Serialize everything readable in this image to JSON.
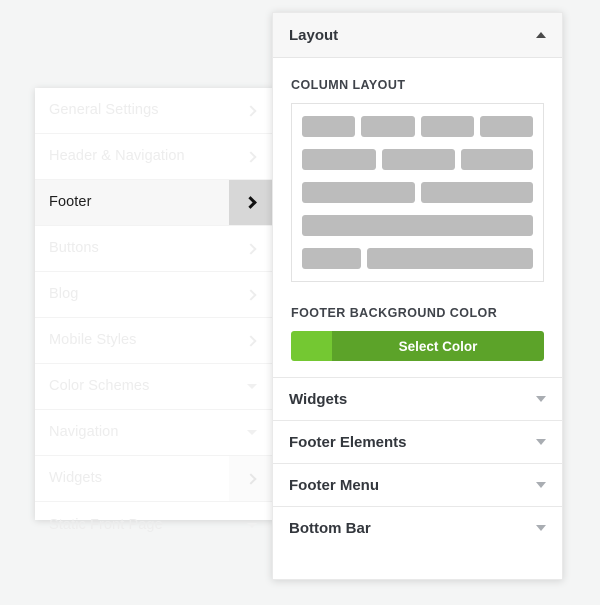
{
  "sidebar": {
    "items": [
      {
        "label": "General Settings",
        "indicator": "chevron-right-icon",
        "state": "inactive"
      },
      {
        "label": "Header & Navigation",
        "indicator": "chevron-right-icon",
        "state": "inactive"
      },
      {
        "label": "Footer",
        "indicator": "chevron-right-icon",
        "state": "active"
      },
      {
        "label": "Buttons",
        "indicator": "chevron-right-icon",
        "state": "inactive"
      },
      {
        "label": "Blog",
        "indicator": "chevron-right-icon",
        "state": "inactive"
      },
      {
        "label": "Mobile Styles",
        "indicator": "chevron-right-icon",
        "state": "inactive"
      },
      {
        "label": "Color Schemes",
        "indicator": "chevron-down-icon",
        "state": "inactive"
      },
      {
        "label": "Navigation",
        "indicator": "chevron-down-icon",
        "state": "inactive"
      },
      {
        "label": "Widgets",
        "indicator": "chevron-right-icon",
        "state": "soft"
      },
      {
        "label": "Static Front Page",
        "indicator": "chevron-down-icon",
        "state": "inactive"
      }
    ]
  },
  "panel": {
    "header": {
      "title": "Layout",
      "toggle_icon": "chevron-up-icon"
    },
    "column_layout": {
      "label": "COLUMN LAYOUT",
      "rows": [
        {
          "name": "four-column",
          "widths": [
            25,
            25,
            25,
            25
          ]
        },
        {
          "name": "three-column",
          "widths": [
            34,
            33,
            33
          ]
        },
        {
          "name": "two-column",
          "widths": [
            50,
            50
          ]
        },
        {
          "name": "one-column",
          "widths": [
            100
          ]
        },
        {
          "name": "quarter-three-quarter",
          "widths": [
            26,
            74
          ]
        }
      ]
    },
    "footer_background": {
      "label": "FOOTER BACKGROUND COLOR",
      "button_label": "Select Color",
      "swatch_color": "#74c832",
      "button_color": "#5ca329"
    },
    "sections": [
      {
        "label": "Widgets",
        "toggle_icon": "chevron-down-icon"
      },
      {
        "label": "Footer Elements",
        "toggle_icon": "chevron-down-icon"
      },
      {
        "label": "Footer Menu",
        "toggle_icon": "chevron-down-icon"
      },
      {
        "label": "Bottom Bar",
        "toggle_icon": "chevron-down-icon"
      }
    ]
  }
}
